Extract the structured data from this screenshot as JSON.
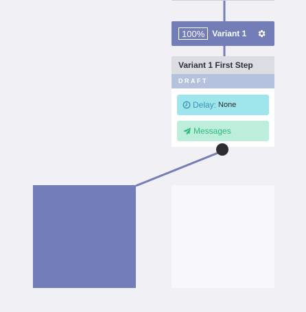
{
  "variant": {
    "percentage": "100%",
    "name": "Variant 1"
  },
  "step": {
    "title": "Variant 1 First Step",
    "status": "DRAFT",
    "delay_label": "Delay:",
    "delay_value": "None",
    "messages_label": "Messages"
  },
  "icons": {
    "settings": "gear-icon",
    "delay": "clock-icon",
    "messages": "paper-plane-icon"
  },
  "colors": {
    "accent": "#737db7",
    "delay_bg": "#9ee5ec",
    "messages_bg": "#bdeedb",
    "draft_bg": "#b5c2dd"
  }
}
